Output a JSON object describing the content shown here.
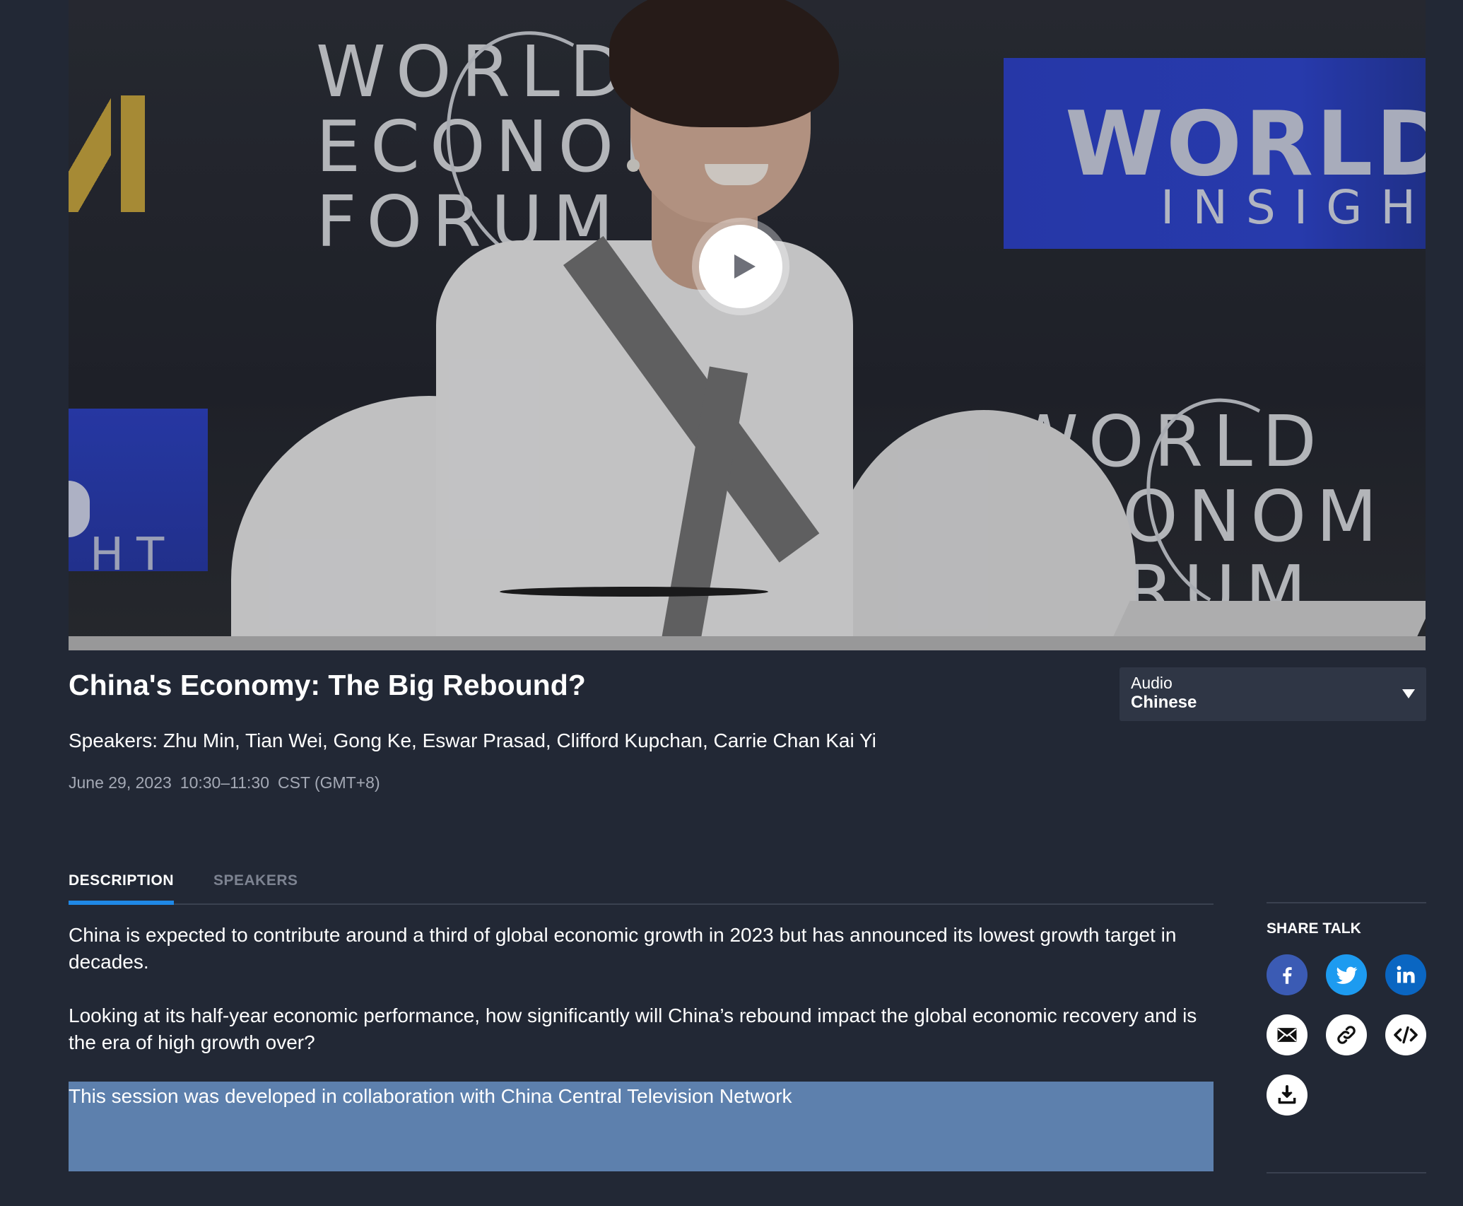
{
  "video": {
    "backdrop_text": {
      "left_logo": [
        "WORLD",
        "ECONOMIC",
        "FORUM"
      ],
      "right_logo": [
        "WORLD",
        "ECONOM",
        "FORUM"
      ],
      "banner_title": "WORLD",
      "banner_subtitle": "INSIGHT",
      "left_fragment": "HT"
    },
    "play_icon": "play-icon"
  },
  "talk": {
    "title": "China's Economy: The Big Rebound?",
    "speakers": "Speakers: Zhu Min, Tian Wei, Gong Ke, Eswar Prasad, Clifford Kupchan, Carrie Chan Kai Yi",
    "date": "June 29, 2023",
    "time": "10:30–11:30",
    "timezone": "CST (GMT+8)"
  },
  "audio": {
    "label": "Audio",
    "selected": "Chinese"
  },
  "tabs": [
    {
      "label": "DESCRIPTION",
      "active": true
    },
    {
      "label": "SPEAKERS",
      "active": false
    }
  ],
  "description": {
    "paragraphs": [
      "China is expected to contribute around a third of global economic growth in 2023 but has announced its lowest growth target in decades.",
      "Looking at its half-year economic performance, how significantly will China’s rebound impact the global economic recovery and is the era of high growth over?",
      "This session was developed in collaboration with China Central Television Network"
    ]
  },
  "share": {
    "title": "SHARE TALK",
    "buttons": [
      {
        "icon": "facebook-icon",
        "color": "#3b5bb4"
      },
      {
        "icon": "twitter-icon",
        "color": "#1d9bf0"
      },
      {
        "icon": "linkedin-icon",
        "color": "#0a66c2"
      },
      {
        "icon": "email-icon",
        "color": "#ffffff"
      },
      {
        "icon": "link-icon",
        "color": "#ffffff"
      },
      {
        "icon": "embed-code-icon",
        "color": "#ffffff"
      },
      {
        "icon": "download-icon",
        "color": "#ffffff"
      }
    ]
  },
  "colors": {
    "background": "#222835",
    "accent": "#1f88e6",
    "highlight": "#5d80ad",
    "muted_text": "#a4a9b5"
  }
}
